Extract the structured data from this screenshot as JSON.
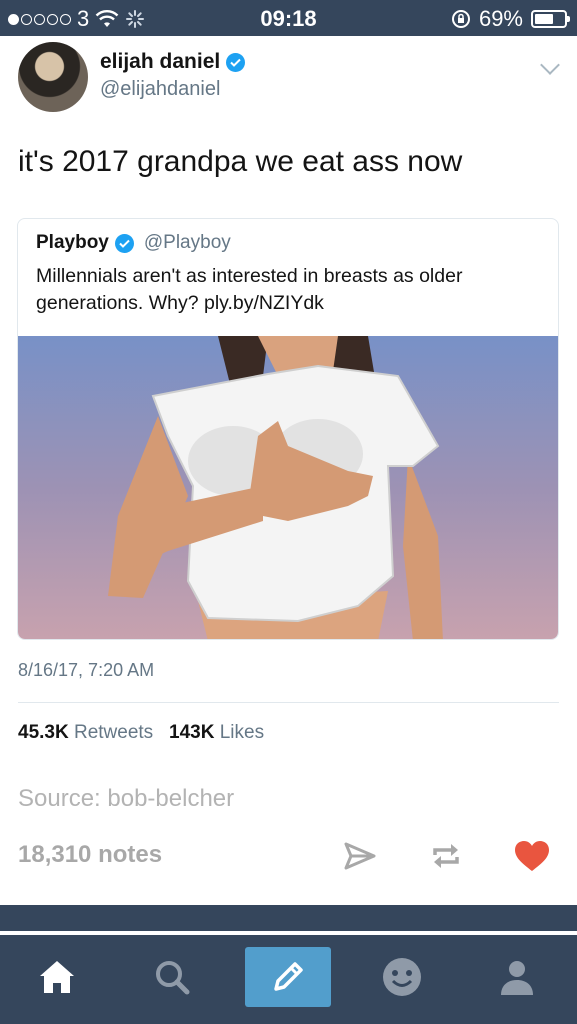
{
  "status_bar": {
    "carrier": "3",
    "time": "09:18",
    "battery": "69%"
  },
  "tweet": {
    "name": "elijah daniel",
    "handle": "@elijahdaniel",
    "text": "it's 2017 grandpa we eat ass now",
    "quote": {
      "name": "Playboy",
      "handle": "@Playboy",
      "text": "Millennials aren't as interested in breasts as older generations. Why? ply.by/NZIYdk"
    },
    "date": "8/16/17, 7:20 AM",
    "retweets_count": "45.3K",
    "retweets_label": "Retweets",
    "likes_count": "143K",
    "likes_label": "Likes"
  },
  "post": {
    "source": "Source: bob-belcher",
    "notes": "18,310 notes"
  },
  "colors": {
    "nav": "#35465c",
    "accent": "#529ecc",
    "heart": "#e9553f",
    "verified": "#1da1f2"
  },
  "icons": [
    "home-icon",
    "search-icon",
    "compose-icon",
    "smile-icon",
    "account-icon",
    "share-icon",
    "reblog-icon",
    "heart-icon"
  ]
}
